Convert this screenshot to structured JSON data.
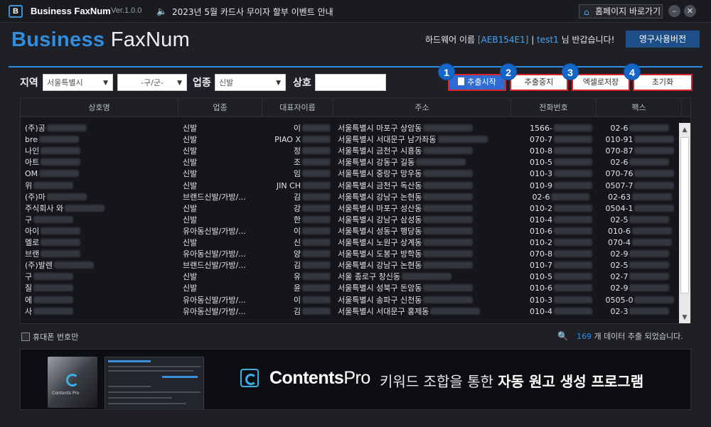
{
  "titlebar": {
    "logo": "B",
    "title": "Business FaxNum",
    "version": "Ver.1.0.0",
    "notice": "2023년 5월 카드사 무이자 할부 이벤트 안내",
    "home_button": "홈페이지 바로가기",
    "min": "–",
    "close": "✕"
  },
  "header": {
    "brand_bold": "Business",
    "brand_light": " FaxNum",
    "hw_label": "하드웨어 이름 ",
    "hw_id": "[AEB154E1]",
    "sep": "  |  ",
    "user": "test1",
    "greeting": " 님 반갑습니다!",
    "license_button": "영구사용버전"
  },
  "filters": {
    "region_label": "지역",
    "region_value": "서울특별시",
    "district_value": "-구/군-",
    "industry_label": "업종",
    "industry_value": "신발",
    "name_label": "상호",
    "name_value": ""
  },
  "actions": {
    "start": "추출시작",
    "stop": "추출중지",
    "excel": "엑셀로저장",
    "reset": "초기화",
    "badges": [
      "1",
      "2",
      "3",
      "4"
    ]
  },
  "table": {
    "columns": [
      "상호명",
      "업종",
      "대표자이름",
      "주소",
      "전화번호",
      "팩스"
    ],
    "rows": [
      [
        "(주)공",
        "신발",
        "이",
        "서울특별시 마포구 상암동",
        "1566-",
        "02-6"
      ],
      [
        "bre",
        "신발",
        "PIAO X",
        "서울특별시 서대문구 남가좌동",
        "070-7",
        "010-91"
      ],
      [
        "나인",
        "신발",
        "정",
        "서울특별시 금천구 시흥동",
        "010-8",
        "070-87"
      ],
      [
        "아트",
        "신발",
        "조",
        "서울특별시 강동구 길동",
        "010-5",
        "02-6"
      ],
      [
        "OM",
        "신발",
        "임",
        "서울특별시 중랑구 망우동",
        "010-3",
        "070-76"
      ],
      [
        "위",
        "신발",
        "JIN CH",
        "서울특별시 금천구 독산동",
        "010-9",
        "0507-7"
      ],
      [
        "(주)마",
        "브랜드신발/가방/...",
        "김",
        "서울특별시 강남구 논현동",
        "02-6",
        "02-63"
      ],
      [
        "주식회사 와",
        "신발",
        "강",
        "서울특별시 마포구 성산동",
        "010-2",
        "0504-1"
      ],
      [
        "구",
        "신발",
        "한",
        "서울특별시 강남구 삼성동",
        "010-4",
        "02-5"
      ],
      [
        "아이",
        "유아동신발/가방/...",
        "이",
        "서울특별시 성동구 행당동",
        "010-6",
        "010-6"
      ],
      [
        "멜로",
        "신발",
        "신",
        "서울특별시 노원구 상계동",
        "010-2",
        "070-4"
      ],
      [
        "브랜",
        "유아동신발/가방/...",
        "양",
        "서울특별시 도봉구 방학동",
        "070-8",
        "02-9"
      ],
      [
        "(주)발렌",
        "브랜드신발/가방/...",
        "김",
        "서울특별시 강남구 논현동",
        "010-7",
        "02-5"
      ],
      [
        "구",
        "신발",
        "유",
        "서울 종로구 창신동",
        "010-5",
        "02-7"
      ],
      [
        "질",
        "신발",
        "윤",
        "서울특별시 성북구 돈암동",
        "010-6",
        "02-9"
      ],
      [
        "에",
        "유아동신발/가방/...",
        "이",
        "서울특별시 송파구 신천동",
        "010-3",
        "0505-0"
      ],
      [
        "사",
        "유아동신발/가방/...",
        "김",
        "서울특별시 서대문구 홍제동",
        "010-4",
        "02-3"
      ]
    ]
  },
  "footer": {
    "mobile_only": "휴대폰 번호만",
    "count": "169",
    "count_suffix": " 개 데이터 추출 되었습니다."
  },
  "banner": {
    "box_label": "Contents Pro",
    "brand_bold": "Contents",
    "brand_light": "Pro",
    "tag_light": "키워드 조합을 통한 ",
    "tag_bold": "자동 원고 생성 프로그램"
  },
  "colors": {
    "accent": "#2f8ee0",
    "highlight": "#d8232a",
    "badge": "#1466c8"
  }
}
